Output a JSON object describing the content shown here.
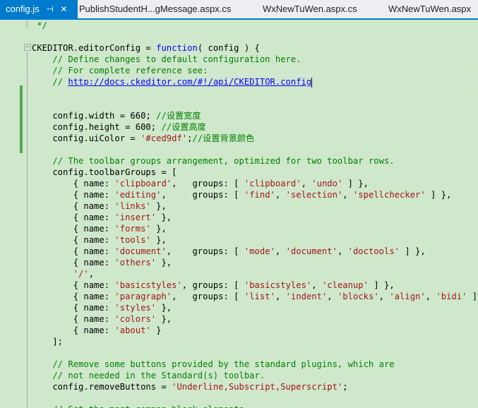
{
  "tabs": [
    {
      "label": "config.js",
      "pin": "⊣",
      "close": "✕",
      "active": true
    },
    {
      "label": "PublishStudentH...gMessage.aspx.cs",
      "active": false
    },
    {
      "label": "WxNewTuWen.aspx.cs",
      "active": false
    },
    {
      "label": "WxNewTuWen.aspx",
      "active": false
    }
  ],
  "code": [
    [
      {
        "t": " */",
        "c": "c"
      }
    ],
    [],
    [
      {
        "t": "CKEDITOR.editorConfig = "
      },
      {
        "t": "function",
        "c": "k"
      },
      {
        "t": "( config ) {"
      }
    ],
    [
      {
        "t": "    // Define changes to default configuration here.",
        "c": "c"
      }
    ],
    [
      {
        "t": "    // For complete reference see:",
        "c": "c"
      }
    ],
    [
      {
        "t": "    // ",
        "c": "c"
      },
      {
        "t": "http://docs.ckeditor.com/#!/api/CKEDITOR.config",
        "c": "u"
      }
    ],
    [],
    [],
    [
      {
        "t": "    config.width = 660; "
      },
      {
        "t": "//设置宽度",
        "c": "c"
      }
    ],
    [
      {
        "t": "    config.height = 600; "
      },
      {
        "t": "//设置高度",
        "c": "c"
      }
    ],
    [
      {
        "t": "    config.uiColor = "
      },
      {
        "t": "'#ced9df'",
        "c": "s"
      },
      {
        "t": ";"
      },
      {
        "t": "//设置背景颜色",
        "c": "c"
      }
    ],
    [],
    [
      {
        "t": "    // The toolbar groups arrangement, optimized for two toolbar rows.",
        "c": "c"
      }
    ],
    [
      {
        "t": "    config.toolbarGroups = ["
      }
    ],
    [
      {
        "t": "        { name: "
      },
      {
        "t": "'clipboard'",
        "c": "s"
      },
      {
        "t": ",   groups: [ "
      },
      {
        "t": "'clipboard'",
        "c": "s"
      },
      {
        "t": ", "
      },
      {
        "t": "'undo'",
        "c": "s"
      },
      {
        "t": " ] },"
      }
    ],
    [
      {
        "t": "        { name: "
      },
      {
        "t": "'editing'",
        "c": "s"
      },
      {
        "t": ",     groups: [ "
      },
      {
        "t": "'find'",
        "c": "s"
      },
      {
        "t": ", "
      },
      {
        "t": "'selection'",
        "c": "s"
      },
      {
        "t": ", "
      },
      {
        "t": "'spellchecker'",
        "c": "s"
      },
      {
        "t": " ] },"
      }
    ],
    [
      {
        "t": "        { name: "
      },
      {
        "t": "'links'",
        "c": "s"
      },
      {
        "t": " },"
      }
    ],
    [
      {
        "t": "        { name: "
      },
      {
        "t": "'insert'",
        "c": "s"
      },
      {
        "t": " },"
      }
    ],
    [
      {
        "t": "        { name: "
      },
      {
        "t": "'forms'",
        "c": "s"
      },
      {
        "t": " },"
      }
    ],
    [
      {
        "t": "        { name: "
      },
      {
        "t": "'tools'",
        "c": "s"
      },
      {
        "t": " },"
      }
    ],
    [
      {
        "t": "        { name: "
      },
      {
        "t": "'document'",
        "c": "s"
      },
      {
        "t": ",    groups: [ "
      },
      {
        "t": "'mode'",
        "c": "s"
      },
      {
        "t": ", "
      },
      {
        "t": "'document'",
        "c": "s"
      },
      {
        "t": ", "
      },
      {
        "t": "'doctools'",
        "c": "s"
      },
      {
        "t": " ] },"
      }
    ],
    [
      {
        "t": "        { name: "
      },
      {
        "t": "'others'",
        "c": "s"
      },
      {
        "t": " },"
      }
    ],
    [
      {
        "t": "        "
      },
      {
        "t": "'/'",
        "c": "s"
      },
      {
        "t": ","
      }
    ],
    [
      {
        "t": "        { name: "
      },
      {
        "t": "'basicstyles'",
        "c": "s"
      },
      {
        "t": ", groups: [ "
      },
      {
        "t": "'basicstyles'",
        "c": "s"
      },
      {
        "t": ", "
      },
      {
        "t": "'cleanup'",
        "c": "s"
      },
      {
        "t": " ] },"
      }
    ],
    [
      {
        "t": "        { name: "
      },
      {
        "t": "'paragraph'",
        "c": "s"
      },
      {
        "t": ",   groups: [ "
      },
      {
        "t": "'list'",
        "c": "s"
      },
      {
        "t": ", "
      },
      {
        "t": "'indent'",
        "c": "s"
      },
      {
        "t": ", "
      },
      {
        "t": "'blocks'",
        "c": "s"
      },
      {
        "t": ", "
      },
      {
        "t": "'align'",
        "c": "s"
      },
      {
        "t": ", "
      },
      {
        "t": "'bidi'",
        "c": "s"
      },
      {
        "t": " ] },"
      }
    ],
    [
      {
        "t": "        { name: "
      },
      {
        "t": "'styles'",
        "c": "s"
      },
      {
        "t": " },"
      }
    ],
    [
      {
        "t": "        { name: "
      },
      {
        "t": "'colors'",
        "c": "s"
      },
      {
        "t": " },"
      }
    ],
    [
      {
        "t": "        { name: "
      },
      {
        "t": "'about'",
        "c": "s"
      },
      {
        "t": " }"
      }
    ],
    [
      {
        "t": "    ];"
      }
    ],
    [],
    [
      {
        "t": "    // Remove some buttons provided by the standard plugins, which are",
        "c": "c"
      }
    ],
    [
      {
        "t": "    // not needed in the Standard(s) toolbar.",
        "c": "c"
      }
    ],
    [
      {
        "t": "    config.removeButtons = "
      },
      {
        "t": "'Underline,Subscript,Superscript'",
        "c": "s"
      },
      {
        "t": ";"
      }
    ],
    [],
    [
      {
        "t": "    // Set the most common block elements.",
        "c": "c"
      }
    ]
  ],
  "colors": {
    "keyword": "#0000ff",
    "comment": "#008000",
    "string": "#a31515",
    "editor_bg": "#cfe8cc",
    "tab_accent": "#007acc"
  }
}
